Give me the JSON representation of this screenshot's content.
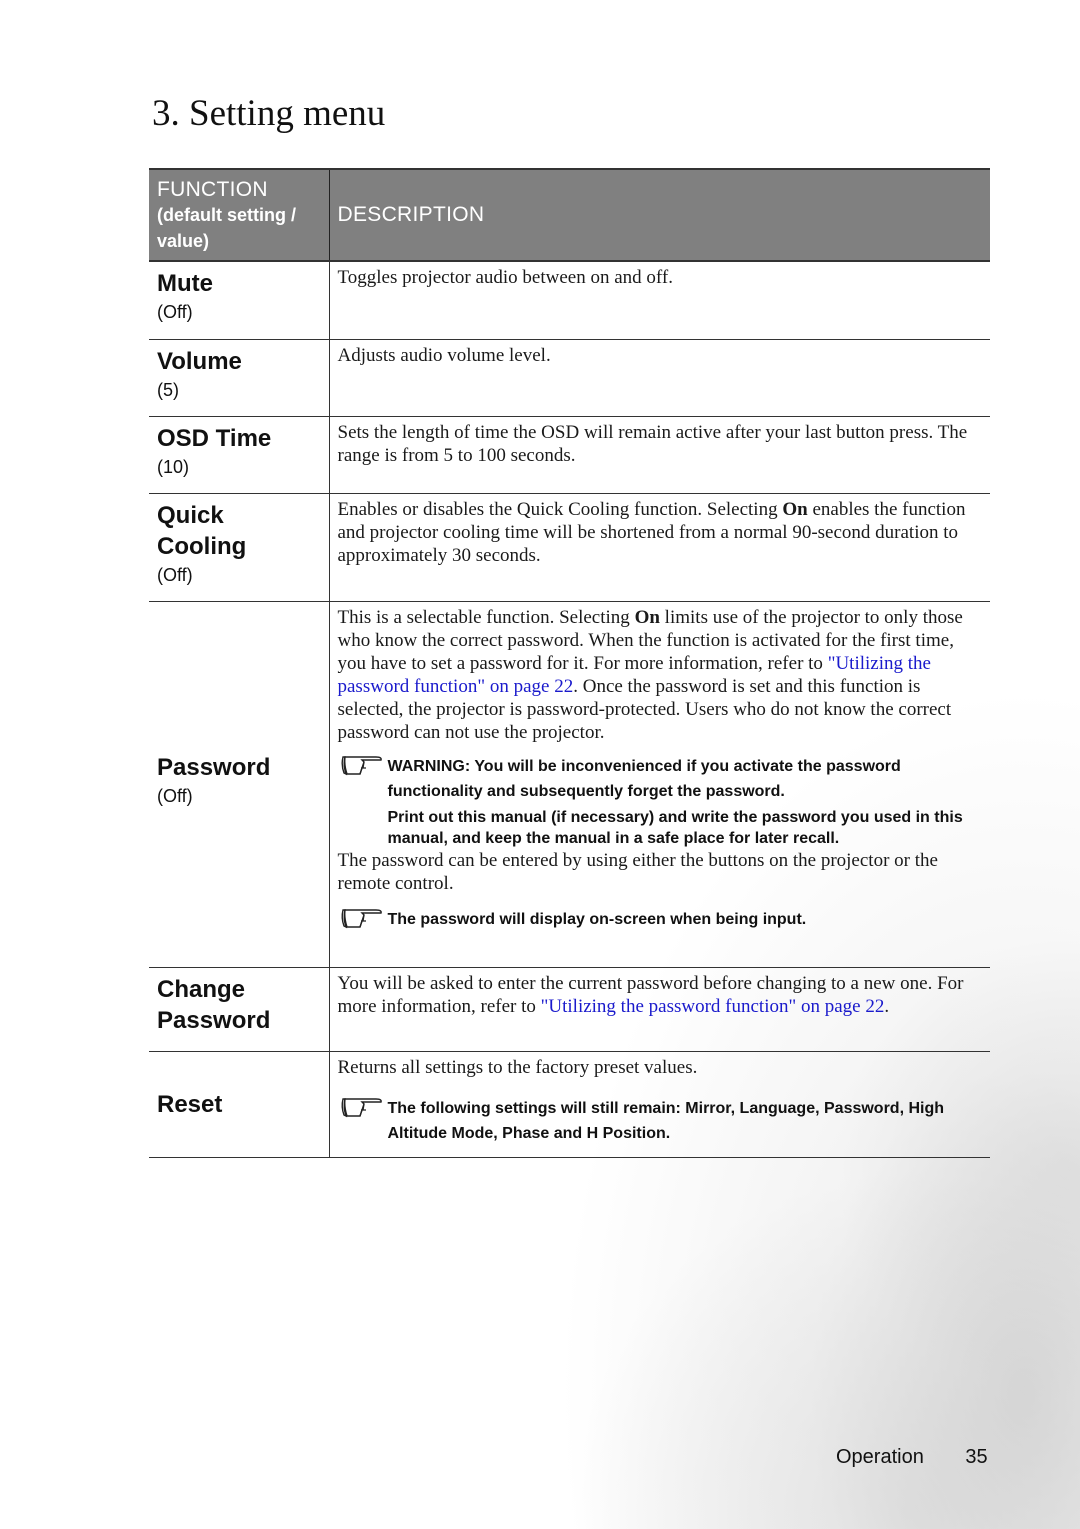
{
  "page": {
    "title": "3. Setting menu",
    "footer": {
      "section": "Operation",
      "page_number": "35"
    }
  },
  "table": {
    "headers": {
      "function": "FUNCTION",
      "function_sub": "(default setting / value)",
      "description": "DESCRIPTION"
    },
    "header_bg_color": "#808080",
    "link_color": "#1a1acc",
    "rows": [
      {
        "name": "Mute",
        "default": "(Off)",
        "desc": "Toggles projector audio between on and off."
      },
      {
        "name": "Volume",
        "default": "(5)",
        "desc": "Adjusts audio volume level."
      },
      {
        "name": "OSD Time",
        "default": "(10)",
        "desc": "Sets the length of time the OSD will remain active after your last button press. The range is from 5 to 100 seconds."
      },
      {
        "name_line1": "Quick",
        "name_line2": "Cooling",
        "default": "(Off)",
        "desc_pre": "Enables or disables the Quick Cooling function. Selecting ",
        "desc_bold": "On",
        "desc_post": " enables the function and projector cooling time will be shortened from a normal 90-second duration to approximately 30 seconds."
      },
      {
        "name": "Password",
        "default": "(Off)",
        "desc_pre": "This is a selectable function. Selecting ",
        "desc_bold": "On",
        "desc_mid": " limits use of the projector to only those who know the correct password. When the function is activated for the first time, you have to set a password for it. For more information, refer to ",
        "desc_link": "\"Utilizing the password function\" on page 22",
        "desc_post": ". Once the password is set and this function is selected, the projector is password-protected. Users who do not know the correct password can not use the projector.",
        "warning_1": "WARNING: You will be inconvenienced if you activate the password functionality and subsequently forget the password.",
        "warning_2": "Print out this manual (if necessary) and write the password you used in this manual, and keep the manual in a safe place for later recall.",
        "desc_2": "The password can be entered by using either the buttons on the projector or the remote control.",
        "note": "The password will display on-screen when being input."
      },
      {
        "name_line1": "Change",
        "name_line2": "Password",
        "desc_pre": "You will be asked to enter the current password before changing to a new one. For more information, refer to ",
        "desc_link": "\"Utilizing the password function\" on page 22",
        "desc_post": "."
      },
      {
        "name": "Reset",
        "desc": "Returns all settings to the factory preset values.",
        "note": "The following settings will still remain: Mirror, Language, Password, High Altitude Mode, Phase and H Position."
      }
    ]
  },
  "icons": {
    "note_icon": "pointing-hand-icon"
  }
}
